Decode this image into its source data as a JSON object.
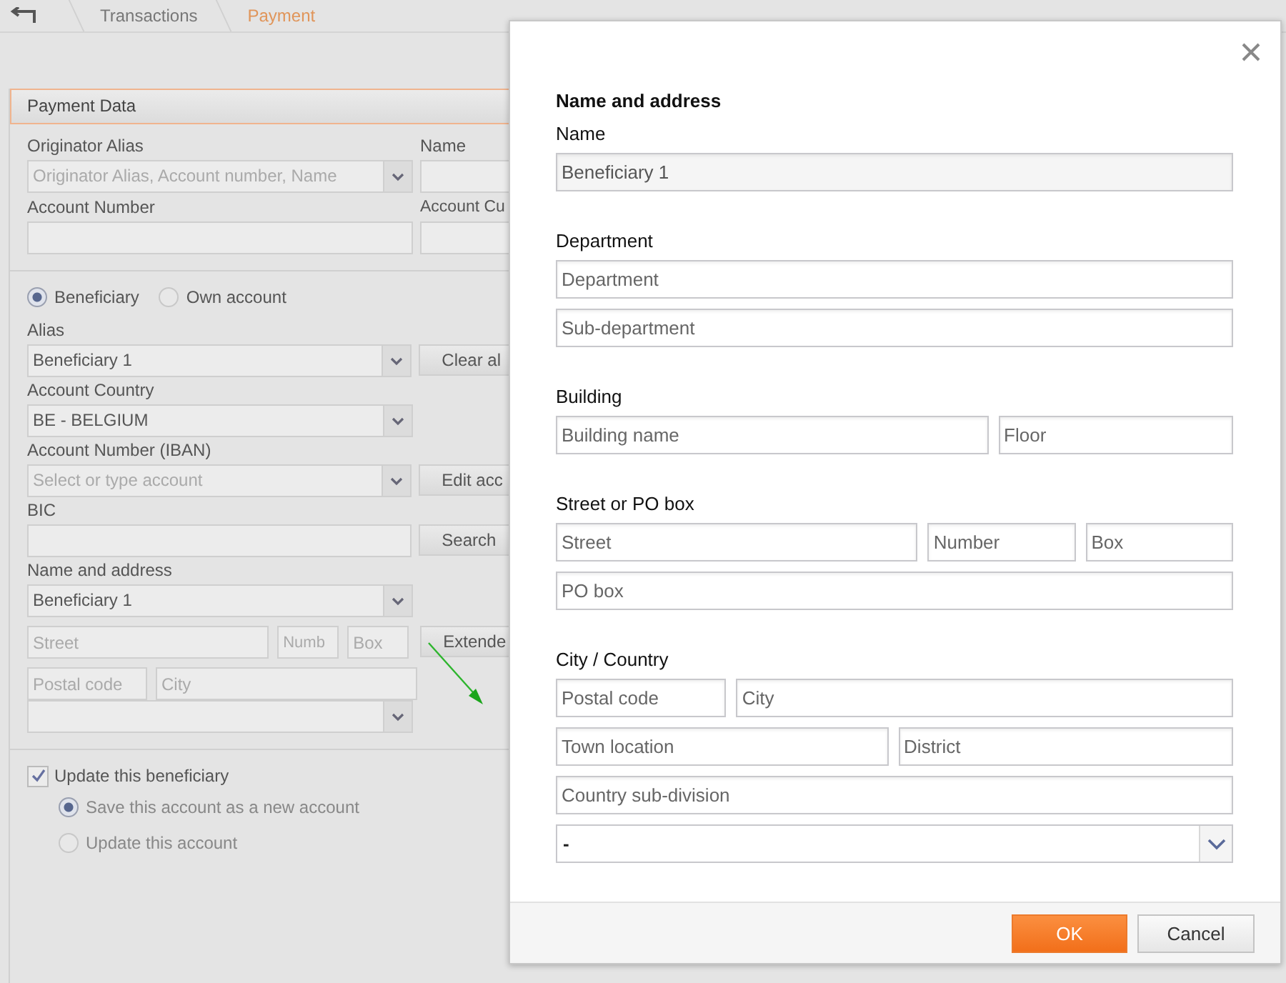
{
  "breadcrumb": [
    {
      "label": "Transactions",
      "selected": false
    },
    {
      "label": "Payment",
      "selected": true
    }
  ],
  "payment_data": {
    "title": "Payment Data",
    "originator_alias": {
      "label": "Originator Alias",
      "placeholder": "Originator Alias, Account number, Name"
    },
    "name": {
      "label": "Name"
    },
    "account_number": {
      "label": "Account Number"
    },
    "account_currency": {
      "label": "Account Cu"
    },
    "party_type": [
      {
        "label": "Beneficiary",
        "selected": true
      },
      {
        "label": "Own account",
        "selected": false
      }
    ],
    "alias": {
      "label": "Alias",
      "value": "Beneficiary 1",
      "button": "Clear al"
    },
    "account_country": {
      "label": "Account Country",
      "value": "BE - BELGIUM"
    },
    "iban": {
      "label": "Account Number (IBAN)",
      "placeholder": "Select or type account",
      "button": "Edit acc"
    },
    "bic": {
      "label": "BIC",
      "button": "Search"
    },
    "name_and_address": {
      "label": "Name and address",
      "value": "Beneficiary 1",
      "street": {
        "placeholder": "Street"
      },
      "number": {
        "placeholder": "Numb"
      },
      "box": {
        "placeholder": "Box"
      },
      "button": "Extende",
      "postal_code": {
        "placeholder": "Postal code"
      },
      "city": {
        "placeholder": "City"
      }
    },
    "update_beneficiary": {
      "label": "Update this beneficiary",
      "checked": true
    },
    "update_options": [
      {
        "label": "Save this account as a new account",
        "selected": true
      },
      {
        "label": "Update this account",
        "selected": false
      }
    ]
  },
  "dialog": {
    "title": "Name and address",
    "sections": [
      {
        "label": "Name",
        "rows": [
          [
            {
              "kind": "text",
              "value": "Beneficiary 1"
            }
          ]
        ]
      },
      {
        "label": "Department",
        "rows": [
          [
            {
              "kind": "text",
              "placeholder": "Department"
            }
          ],
          [
            {
              "kind": "text",
              "placeholder": "Sub-department"
            }
          ]
        ]
      },
      {
        "label": "Building",
        "rows": [
          [
            {
              "kind": "text",
              "placeholder": "Building name"
            },
            {
              "kind": "text",
              "placeholder": "Floor"
            }
          ]
        ]
      },
      {
        "label": "Street or PO box",
        "rows": [
          [
            {
              "kind": "text",
              "placeholder": "Street"
            },
            {
              "kind": "text",
              "placeholder": "Number"
            },
            {
              "kind": "text",
              "placeholder": "Box"
            }
          ],
          [
            {
              "kind": "text",
              "placeholder": "PO box"
            }
          ]
        ]
      },
      {
        "label": "City / Country",
        "rows": [
          [
            {
              "kind": "text",
              "placeholder": "Postal code"
            },
            {
              "kind": "text",
              "placeholder": "City"
            }
          ],
          [
            {
              "kind": "text",
              "placeholder": "Town location"
            },
            {
              "kind": "text",
              "placeholder": "District"
            }
          ],
          [
            {
              "kind": "text",
              "placeholder": "Country sub-division"
            }
          ],
          [
            {
              "kind": "select",
              "value": "-"
            }
          ]
        ]
      }
    ],
    "buttons": [
      {
        "label": "OK",
        "kind": "primary"
      },
      {
        "label": "Cancel",
        "kind": "secondary"
      }
    ]
  }
}
